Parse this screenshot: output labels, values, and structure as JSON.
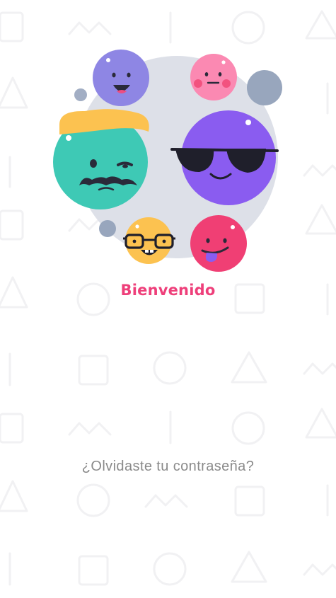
{
  "welcome": {
    "title": "Bienvenido"
  },
  "forgot_password": {
    "label": "¿Olvidaste tu contraseña?"
  },
  "colors": {
    "accent": "#ee3f7a",
    "muted_text": "#8a8a8a",
    "pattern": "#f3f3f3",
    "backdrop": "#dde0e8"
  },
  "emojis": [
    {
      "name": "laughing-purple-face-icon",
      "color": "#8e86e4"
    },
    {
      "name": "blushing-pink-face-icon",
      "color": "#fb89b2"
    },
    {
      "name": "mustache-teal-face-icon",
      "color": "#3ec9b5"
    },
    {
      "name": "sunglasses-purple-face-icon",
      "color": "#8a5cf0"
    },
    {
      "name": "nerd-yellow-face-icon",
      "color": "#fcc250"
    },
    {
      "name": "tongue-pink-face-icon",
      "color": "#f03f74"
    }
  ]
}
